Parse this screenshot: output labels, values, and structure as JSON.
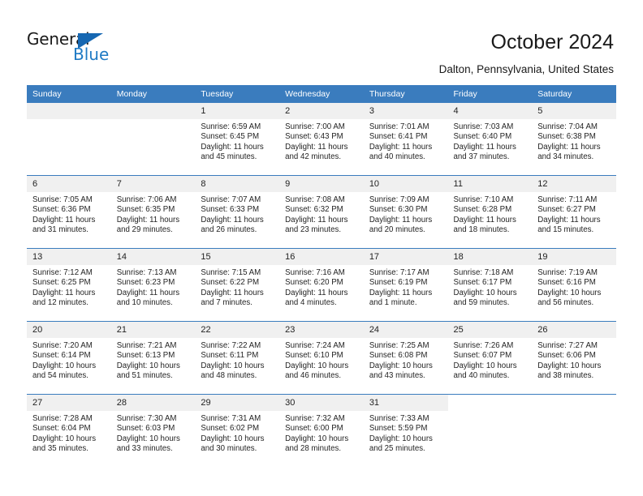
{
  "brand": {
    "name_dark": "General",
    "name_blue": "Blue",
    "triangle_color": "#1667b2",
    "blue_color": "#1f7ac4"
  },
  "header": {
    "title": "October 2024",
    "subtitle": "Dalton, Pennsylvania, United States"
  },
  "theme": {
    "header_bg": "#3a7cbe",
    "daynum_bg": "#f0f0f0",
    "grid_line": "#3a7cbe",
    "text": "#222222"
  },
  "calendar": {
    "weekday_headers": [
      "Sunday",
      "Monday",
      "Tuesday",
      "Wednesday",
      "Thursday",
      "Friday",
      "Saturday"
    ],
    "weeks": [
      [
        {
          "day": "",
          "empty": true
        },
        {
          "day": "",
          "empty": true
        },
        {
          "day": "1",
          "sunrise": "Sunrise: 6:59 AM",
          "sunset": "Sunset: 6:45 PM",
          "daylight": "Daylight: 11 hours and 45 minutes."
        },
        {
          "day": "2",
          "sunrise": "Sunrise: 7:00 AM",
          "sunset": "Sunset: 6:43 PM",
          "daylight": "Daylight: 11 hours and 42 minutes."
        },
        {
          "day": "3",
          "sunrise": "Sunrise: 7:01 AM",
          "sunset": "Sunset: 6:41 PM",
          "daylight": "Daylight: 11 hours and 40 minutes."
        },
        {
          "day": "4",
          "sunrise": "Sunrise: 7:03 AM",
          "sunset": "Sunset: 6:40 PM",
          "daylight": "Daylight: 11 hours and 37 minutes."
        },
        {
          "day": "5",
          "sunrise": "Sunrise: 7:04 AM",
          "sunset": "Sunset: 6:38 PM",
          "daylight": "Daylight: 11 hours and 34 minutes."
        }
      ],
      [
        {
          "day": "6",
          "sunrise": "Sunrise: 7:05 AM",
          "sunset": "Sunset: 6:36 PM",
          "daylight": "Daylight: 11 hours and 31 minutes."
        },
        {
          "day": "7",
          "sunrise": "Sunrise: 7:06 AM",
          "sunset": "Sunset: 6:35 PM",
          "daylight": "Daylight: 11 hours and 29 minutes."
        },
        {
          "day": "8",
          "sunrise": "Sunrise: 7:07 AM",
          "sunset": "Sunset: 6:33 PM",
          "daylight": "Daylight: 11 hours and 26 minutes."
        },
        {
          "day": "9",
          "sunrise": "Sunrise: 7:08 AM",
          "sunset": "Sunset: 6:32 PM",
          "daylight": "Daylight: 11 hours and 23 minutes."
        },
        {
          "day": "10",
          "sunrise": "Sunrise: 7:09 AM",
          "sunset": "Sunset: 6:30 PM",
          "daylight": "Daylight: 11 hours and 20 minutes."
        },
        {
          "day": "11",
          "sunrise": "Sunrise: 7:10 AM",
          "sunset": "Sunset: 6:28 PM",
          "daylight": "Daylight: 11 hours and 18 minutes."
        },
        {
          "day": "12",
          "sunrise": "Sunrise: 7:11 AM",
          "sunset": "Sunset: 6:27 PM",
          "daylight": "Daylight: 11 hours and 15 minutes."
        }
      ],
      [
        {
          "day": "13",
          "sunrise": "Sunrise: 7:12 AM",
          "sunset": "Sunset: 6:25 PM",
          "daylight": "Daylight: 11 hours and 12 minutes."
        },
        {
          "day": "14",
          "sunrise": "Sunrise: 7:13 AM",
          "sunset": "Sunset: 6:23 PM",
          "daylight": "Daylight: 11 hours and 10 minutes."
        },
        {
          "day": "15",
          "sunrise": "Sunrise: 7:15 AM",
          "sunset": "Sunset: 6:22 PM",
          "daylight": "Daylight: 11 hours and 7 minutes."
        },
        {
          "day": "16",
          "sunrise": "Sunrise: 7:16 AM",
          "sunset": "Sunset: 6:20 PM",
          "daylight": "Daylight: 11 hours and 4 minutes."
        },
        {
          "day": "17",
          "sunrise": "Sunrise: 7:17 AM",
          "sunset": "Sunset: 6:19 PM",
          "daylight": "Daylight: 11 hours and 1 minute."
        },
        {
          "day": "18",
          "sunrise": "Sunrise: 7:18 AM",
          "sunset": "Sunset: 6:17 PM",
          "daylight": "Daylight: 10 hours and 59 minutes."
        },
        {
          "day": "19",
          "sunrise": "Sunrise: 7:19 AM",
          "sunset": "Sunset: 6:16 PM",
          "daylight": "Daylight: 10 hours and 56 minutes."
        }
      ],
      [
        {
          "day": "20",
          "sunrise": "Sunrise: 7:20 AM",
          "sunset": "Sunset: 6:14 PM",
          "daylight": "Daylight: 10 hours and 54 minutes."
        },
        {
          "day": "21",
          "sunrise": "Sunrise: 7:21 AM",
          "sunset": "Sunset: 6:13 PM",
          "daylight": "Daylight: 10 hours and 51 minutes."
        },
        {
          "day": "22",
          "sunrise": "Sunrise: 7:22 AM",
          "sunset": "Sunset: 6:11 PM",
          "daylight": "Daylight: 10 hours and 48 minutes."
        },
        {
          "day": "23",
          "sunrise": "Sunrise: 7:24 AM",
          "sunset": "Sunset: 6:10 PM",
          "daylight": "Daylight: 10 hours and 46 minutes."
        },
        {
          "day": "24",
          "sunrise": "Sunrise: 7:25 AM",
          "sunset": "Sunset: 6:08 PM",
          "daylight": "Daylight: 10 hours and 43 minutes."
        },
        {
          "day": "25",
          "sunrise": "Sunrise: 7:26 AM",
          "sunset": "Sunset: 6:07 PM",
          "daylight": "Daylight: 10 hours and 40 minutes."
        },
        {
          "day": "26",
          "sunrise": "Sunrise: 7:27 AM",
          "sunset": "Sunset: 6:06 PM",
          "daylight": "Daylight: 10 hours and 38 minutes."
        }
      ],
      [
        {
          "day": "27",
          "sunrise": "Sunrise: 7:28 AM",
          "sunset": "Sunset: 6:04 PM",
          "daylight": "Daylight: 10 hours and 35 minutes."
        },
        {
          "day": "28",
          "sunrise": "Sunrise: 7:30 AM",
          "sunset": "Sunset: 6:03 PM",
          "daylight": "Daylight: 10 hours and 33 minutes."
        },
        {
          "day": "29",
          "sunrise": "Sunrise: 7:31 AM",
          "sunset": "Sunset: 6:02 PM",
          "daylight": "Daylight: 10 hours and 30 minutes."
        },
        {
          "day": "30",
          "sunrise": "Sunrise: 7:32 AM",
          "sunset": "Sunset: 6:00 PM",
          "daylight": "Daylight: 10 hours and 28 minutes."
        },
        {
          "day": "31",
          "sunrise": "Sunrise: 7:33 AM",
          "sunset": "Sunset: 5:59 PM",
          "daylight": "Daylight: 10 hours and 25 minutes."
        },
        {
          "day": "",
          "blank": true
        },
        {
          "day": "",
          "blank": true
        }
      ]
    ]
  }
}
